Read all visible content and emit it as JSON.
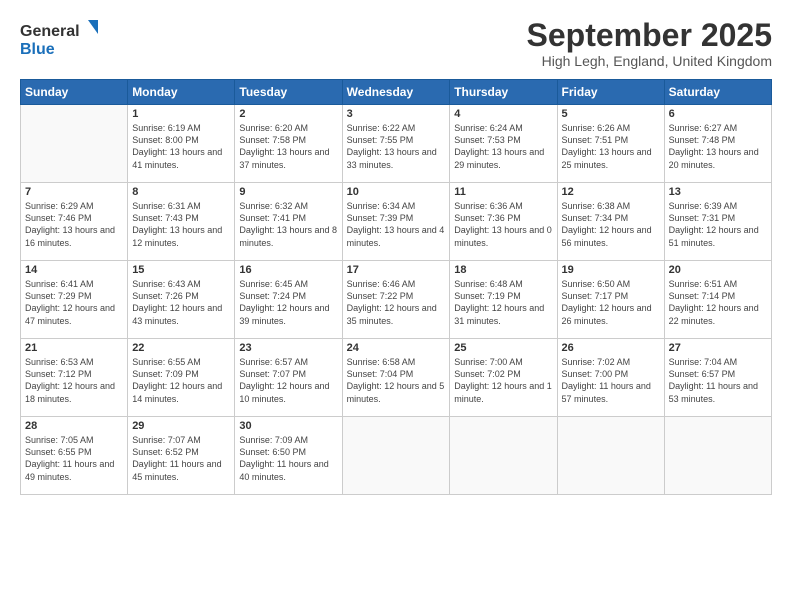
{
  "logo": {
    "general": "General",
    "blue": "Blue"
  },
  "title": "September 2025",
  "location": "High Legh, England, United Kingdom",
  "days_of_week": [
    "Sunday",
    "Monday",
    "Tuesday",
    "Wednesday",
    "Thursday",
    "Friday",
    "Saturday"
  ],
  "weeks": [
    [
      {
        "day": "",
        "info": ""
      },
      {
        "day": "1",
        "info": "Sunrise: 6:19 AM\nSunset: 8:00 PM\nDaylight: 13 hours\nand 41 minutes."
      },
      {
        "day": "2",
        "info": "Sunrise: 6:20 AM\nSunset: 7:58 PM\nDaylight: 13 hours\nand 37 minutes."
      },
      {
        "day": "3",
        "info": "Sunrise: 6:22 AM\nSunset: 7:55 PM\nDaylight: 13 hours\nand 33 minutes."
      },
      {
        "day": "4",
        "info": "Sunrise: 6:24 AM\nSunset: 7:53 PM\nDaylight: 13 hours\nand 29 minutes."
      },
      {
        "day": "5",
        "info": "Sunrise: 6:26 AM\nSunset: 7:51 PM\nDaylight: 13 hours\nand 25 minutes."
      },
      {
        "day": "6",
        "info": "Sunrise: 6:27 AM\nSunset: 7:48 PM\nDaylight: 13 hours\nand 20 minutes."
      }
    ],
    [
      {
        "day": "7",
        "info": "Sunrise: 6:29 AM\nSunset: 7:46 PM\nDaylight: 13 hours\nand 16 minutes."
      },
      {
        "day": "8",
        "info": "Sunrise: 6:31 AM\nSunset: 7:43 PM\nDaylight: 13 hours\nand 12 minutes."
      },
      {
        "day": "9",
        "info": "Sunrise: 6:32 AM\nSunset: 7:41 PM\nDaylight: 13 hours\nand 8 minutes."
      },
      {
        "day": "10",
        "info": "Sunrise: 6:34 AM\nSunset: 7:39 PM\nDaylight: 13 hours\nand 4 minutes."
      },
      {
        "day": "11",
        "info": "Sunrise: 6:36 AM\nSunset: 7:36 PM\nDaylight: 13 hours\nand 0 minutes."
      },
      {
        "day": "12",
        "info": "Sunrise: 6:38 AM\nSunset: 7:34 PM\nDaylight: 12 hours\nand 56 minutes."
      },
      {
        "day": "13",
        "info": "Sunrise: 6:39 AM\nSunset: 7:31 PM\nDaylight: 12 hours\nand 51 minutes."
      }
    ],
    [
      {
        "day": "14",
        "info": "Sunrise: 6:41 AM\nSunset: 7:29 PM\nDaylight: 12 hours\nand 47 minutes."
      },
      {
        "day": "15",
        "info": "Sunrise: 6:43 AM\nSunset: 7:26 PM\nDaylight: 12 hours\nand 43 minutes."
      },
      {
        "day": "16",
        "info": "Sunrise: 6:45 AM\nSunset: 7:24 PM\nDaylight: 12 hours\nand 39 minutes."
      },
      {
        "day": "17",
        "info": "Sunrise: 6:46 AM\nSunset: 7:22 PM\nDaylight: 12 hours\nand 35 minutes."
      },
      {
        "day": "18",
        "info": "Sunrise: 6:48 AM\nSunset: 7:19 PM\nDaylight: 12 hours\nand 31 minutes."
      },
      {
        "day": "19",
        "info": "Sunrise: 6:50 AM\nSunset: 7:17 PM\nDaylight: 12 hours\nand 26 minutes."
      },
      {
        "day": "20",
        "info": "Sunrise: 6:51 AM\nSunset: 7:14 PM\nDaylight: 12 hours\nand 22 minutes."
      }
    ],
    [
      {
        "day": "21",
        "info": "Sunrise: 6:53 AM\nSunset: 7:12 PM\nDaylight: 12 hours\nand 18 minutes."
      },
      {
        "day": "22",
        "info": "Sunrise: 6:55 AM\nSunset: 7:09 PM\nDaylight: 12 hours\nand 14 minutes."
      },
      {
        "day": "23",
        "info": "Sunrise: 6:57 AM\nSunset: 7:07 PM\nDaylight: 12 hours\nand 10 minutes."
      },
      {
        "day": "24",
        "info": "Sunrise: 6:58 AM\nSunset: 7:04 PM\nDaylight: 12 hours\nand 5 minutes."
      },
      {
        "day": "25",
        "info": "Sunrise: 7:00 AM\nSunset: 7:02 PM\nDaylight: 12 hours\nand 1 minute."
      },
      {
        "day": "26",
        "info": "Sunrise: 7:02 AM\nSunset: 7:00 PM\nDaylight: 11 hours\nand 57 minutes."
      },
      {
        "day": "27",
        "info": "Sunrise: 7:04 AM\nSunset: 6:57 PM\nDaylight: 11 hours\nand 53 minutes."
      }
    ],
    [
      {
        "day": "28",
        "info": "Sunrise: 7:05 AM\nSunset: 6:55 PM\nDaylight: 11 hours\nand 49 minutes."
      },
      {
        "day": "29",
        "info": "Sunrise: 7:07 AM\nSunset: 6:52 PM\nDaylight: 11 hours\nand 45 minutes."
      },
      {
        "day": "30",
        "info": "Sunrise: 7:09 AM\nSunset: 6:50 PM\nDaylight: 11 hours\nand 40 minutes."
      },
      {
        "day": "",
        "info": ""
      },
      {
        "day": "",
        "info": ""
      },
      {
        "day": "",
        "info": ""
      },
      {
        "day": "",
        "info": ""
      }
    ]
  ]
}
